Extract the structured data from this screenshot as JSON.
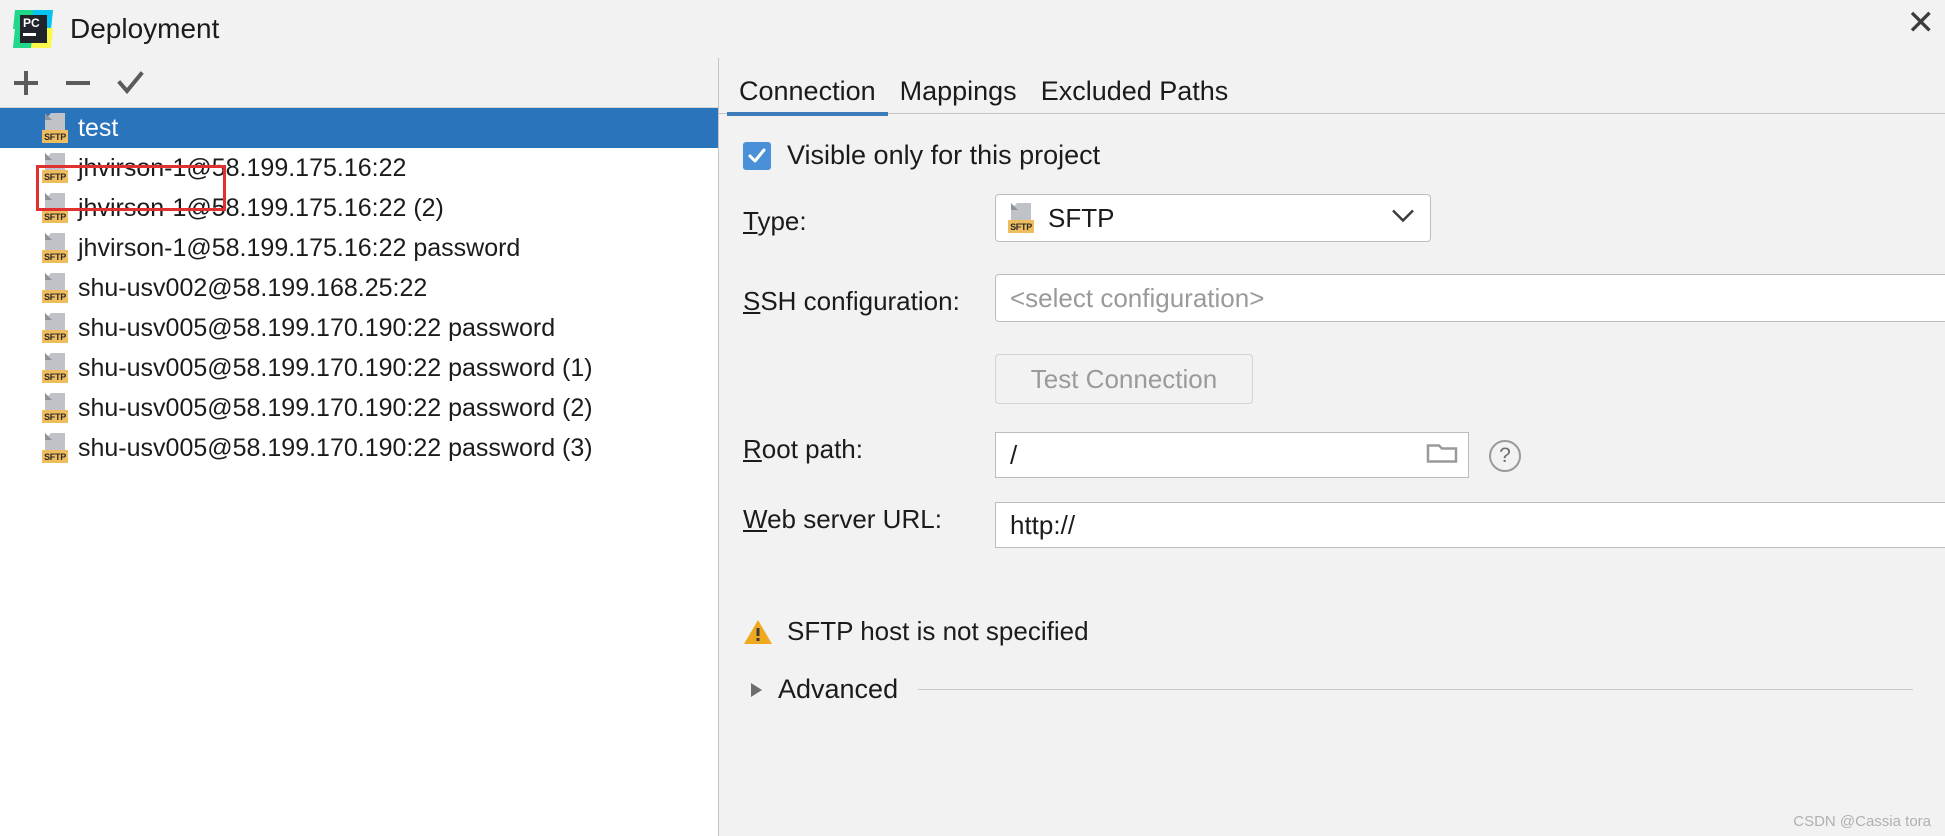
{
  "window": {
    "title": "Deployment",
    "app_icon": "pycharm-icon",
    "close_label": "✕"
  },
  "toolbar": {
    "add_label": "+",
    "remove_label": "−",
    "apply_label": "✓",
    "buttons": [
      {
        "name": "add-server-button",
        "icon": "plus-icon"
      },
      {
        "name": "remove-server-button",
        "icon": "minus-icon"
      },
      {
        "name": "set-default-button",
        "icon": "check-icon"
      }
    ]
  },
  "server_list": {
    "icon_tag": "SFTP",
    "items": [
      {
        "label": "test",
        "selected": true
      },
      {
        "label": "jhvirson-1@58.199.175.16:22",
        "selected": false
      },
      {
        "label": "jhvirson-1@58.199.175.16:22 (2)",
        "selected": false
      },
      {
        "label": "jhvirson-1@58.199.175.16:22 password",
        "selected": false
      },
      {
        "label": "shu-usv002@58.199.168.25:22",
        "selected": false
      },
      {
        "label": "shu-usv005@58.199.170.190:22 password",
        "selected": false
      },
      {
        "label": "shu-usv005@58.199.170.190:22 password (1)",
        "selected": false
      },
      {
        "label": "shu-usv005@58.199.170.190:22 password (2)",
        "selected": false
      },
      {
        "label": "shu-usv005@58.199.170.190:22 password (3)",
        "selected": false
      }
    ]
  },
  "tabs": [
    {
      "label": "Connection",
      "active": true
    },
    {
      "label": "Mappings",
      "active": false
    },
    {
      "label": "Excluded Paths",
      "active": false
    }
  ],
  "connection": {
    "visible_only_checkbox": {
      "label": "Visible only for this project",
      "checked": true
    },
    "type": {
      "label_prefix": "",
      "mnemonic": "T",
      "label_suffix": "ype:",
      "value": "SFTP",
      "icon_tag": "SFTP"
    },
    "ssh_configuration": {
      "mnemonic": "S",
      "label_suffix": "SH configuration:",
      "placeholder": "<select configuration>",
      "value": ""
    },
    "test_connection": {
      "label": "Test Connection",
      "enabled": false
    },
    "root_path": {
      "mnemonic": "R",
      "label_suffix": "oot path:",
      "value": "/",
      "browse_icon": "folder-icon",
      "help_icon": "question-mark-icon",
      "help_label": "?"
    },
    "web_server_url": {
      "mnemonic": "W",
      "label_suffix": "eb server URL:",
      "value": "http://"
    },
    "warning": {
      "icon": "warning-triangle-icon",
      "text": "SFTP host is not specified"
    },
    "advanced": {
      "label": "Advanced",
      "expanded": false
    }
  },
  "watermark": "CSDN @Cassia tora",
  "colors": {
    "selection_blue": "#2a74bc",
    "accent_blue": "#3d7cb8",
    "checkbox_blue": "#4a90d9",
    "highlight_red": "#e03030",
    "sftp_tag_orange": "#f0bd5e",
    "warning_amber": "#f0a91e",
    "panel_gray": "#f2f2f2"
  }
}
